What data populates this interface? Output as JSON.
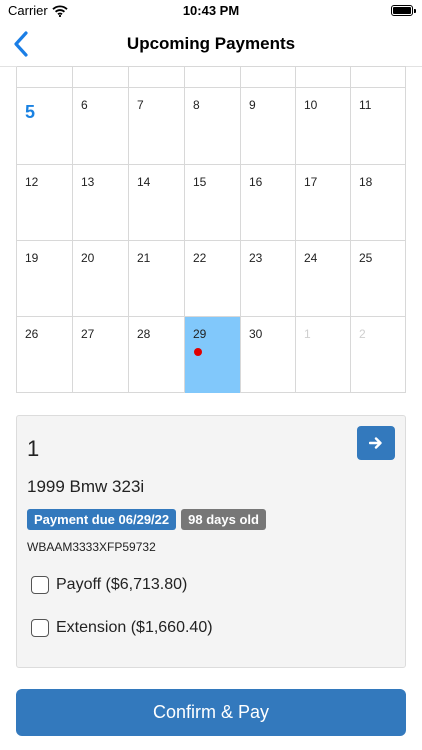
{
  "status_bar": {
    "carrier": "Carrier",
    "time": "10:43 PM"
  },
  "nav": {
    "title": "Upcoming Payments"
  },
  "calendar": {
    "today": "5",
    "selected": "29",
    "weeks": [
      [
        "",
        "",
        "",
        "",
        "",
        "",
        ""
      ],
      [
        "5",
        "6",
        "7",
        "8",
        "9",
        "10",
        "11"
      ],
      [
        "12",
        "13",
        "14",
        "15",
        "16",
        "17",
        "18"
      ],
      [
        "19",
        "20",
        "21",
        "22",
        "23",
        "24",
        "25"
      ],
      [
        "26",
        "27",
        "28",
        "29",
        "30",
        "1",
        "2"
      ]
    ]
  },
  "payment": {
    "index": "1",
    "vehicle": "1999 Bmw 323i",
    "due_badge": "Payment due 06/29/22",
    "age_badge": "98 days old",
    "vin": "WBAAM3333XFP59732",
    "options": [
      {
        "label": "Payoff ($6,713.80)",
        "checked": false
      },
      {
        "label": "Extension ($1,660.40)",
        "checked": false
      }
    ]
  },
  "confirm_button": "Confirm & Pay",
  "colors": {
    "primary": "#3379bd",
    "today": "#1a82e2",
    "selected_day": "#81c8fb",
    "event_dot": "#e00000",
    "badge_gray": "#777777"
  }
}
